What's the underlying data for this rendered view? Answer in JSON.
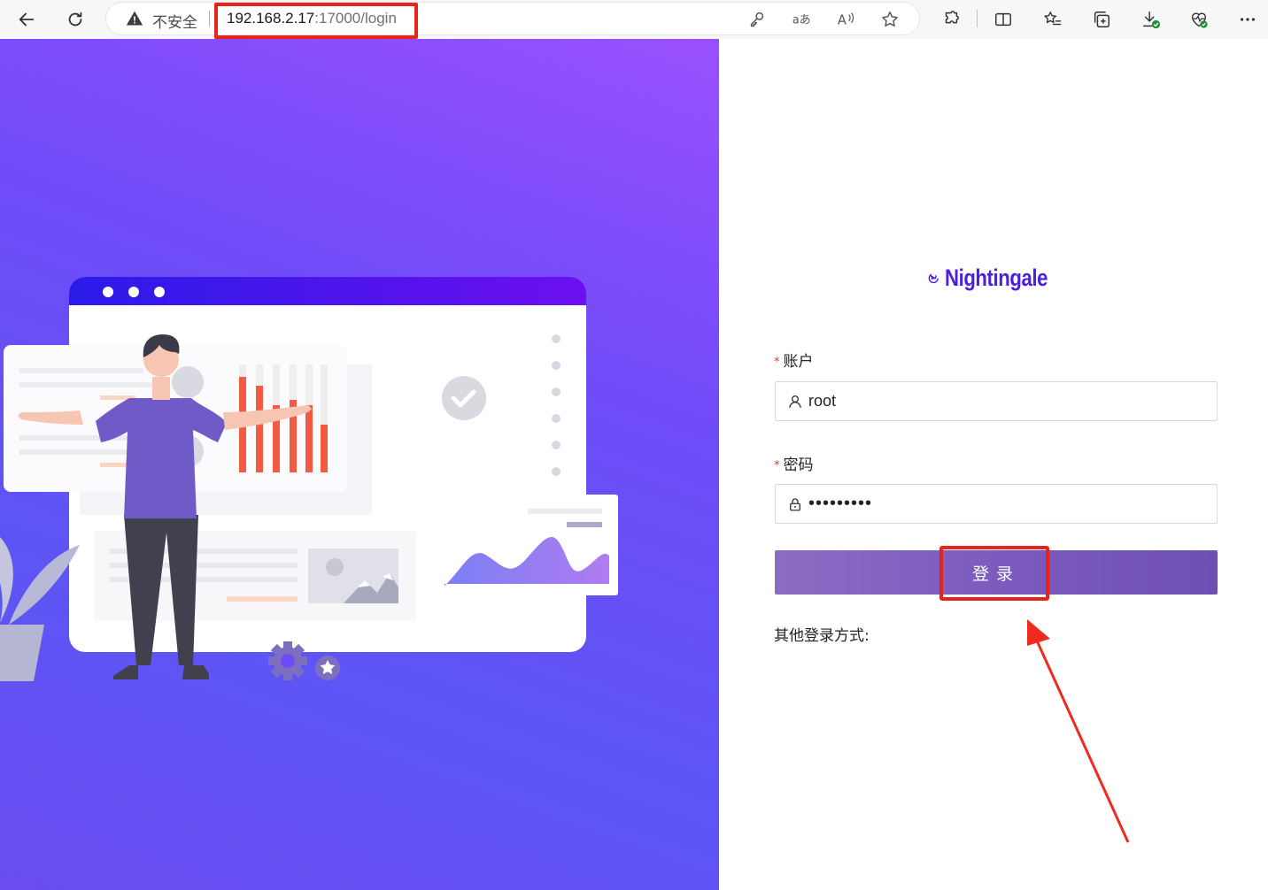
{
  "browser": {
    "security_label": "不安全",
    "url_host": "192.168.2.17",
    "url_rest": ":17000/login"
  },
  "brand": {
    "name": "Nightingale",
    "logo_color": "#4b1ee0"
  },
  "form": {
    "account_label": "账户",
    "account_value": "root",
    "password_label": "密码",
    "password_value": "•••••••••",
    "required_mark": "*",
    "submit_label": "登录",
    "other_login_label": "其他登录方式:"
  },
  "colors": {
    "highlight_red": "#e8231a",
    "button_purple": "#7b5bbd",
    "hero_purple": "#6f4bf7"
  },
  "icons": {
    "back": "arrow-left-icon",
    "reload": "reload-icon",
    "warning": "warning-triangle-icon",
    "user": "user-icon",
    "lock": "lock-icon"
  }
}
